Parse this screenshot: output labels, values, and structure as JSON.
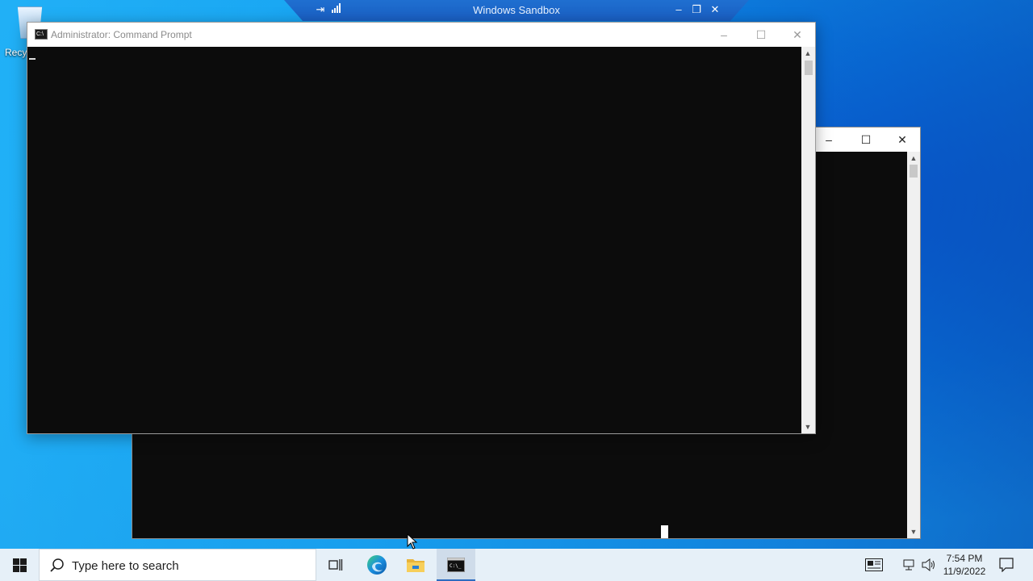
{
  "sandbox": {
    "title": "Windows Sandbox"
  },
  "desktop": {
    "recycle_bin_label": "Recy"
  },
  "front_window": {
    "title": "Administrator: Command Prompt"
  },
  "taskbar": {
    "search_placeholder": "Type here to search",
    "time": "7:54 PM",
    "date": "11/9/2022",
    "apps": [
      "task-view-icon",
      "edge-icon",
      "file-explorer-icon",
      "command-prompt-icon"
    ],
    "active_app": "command-prompt-icon"
  },
  "colors": {
    "accent": "#2d6cc0",
    "console_bg": "#0c0c0c"
  }
}
